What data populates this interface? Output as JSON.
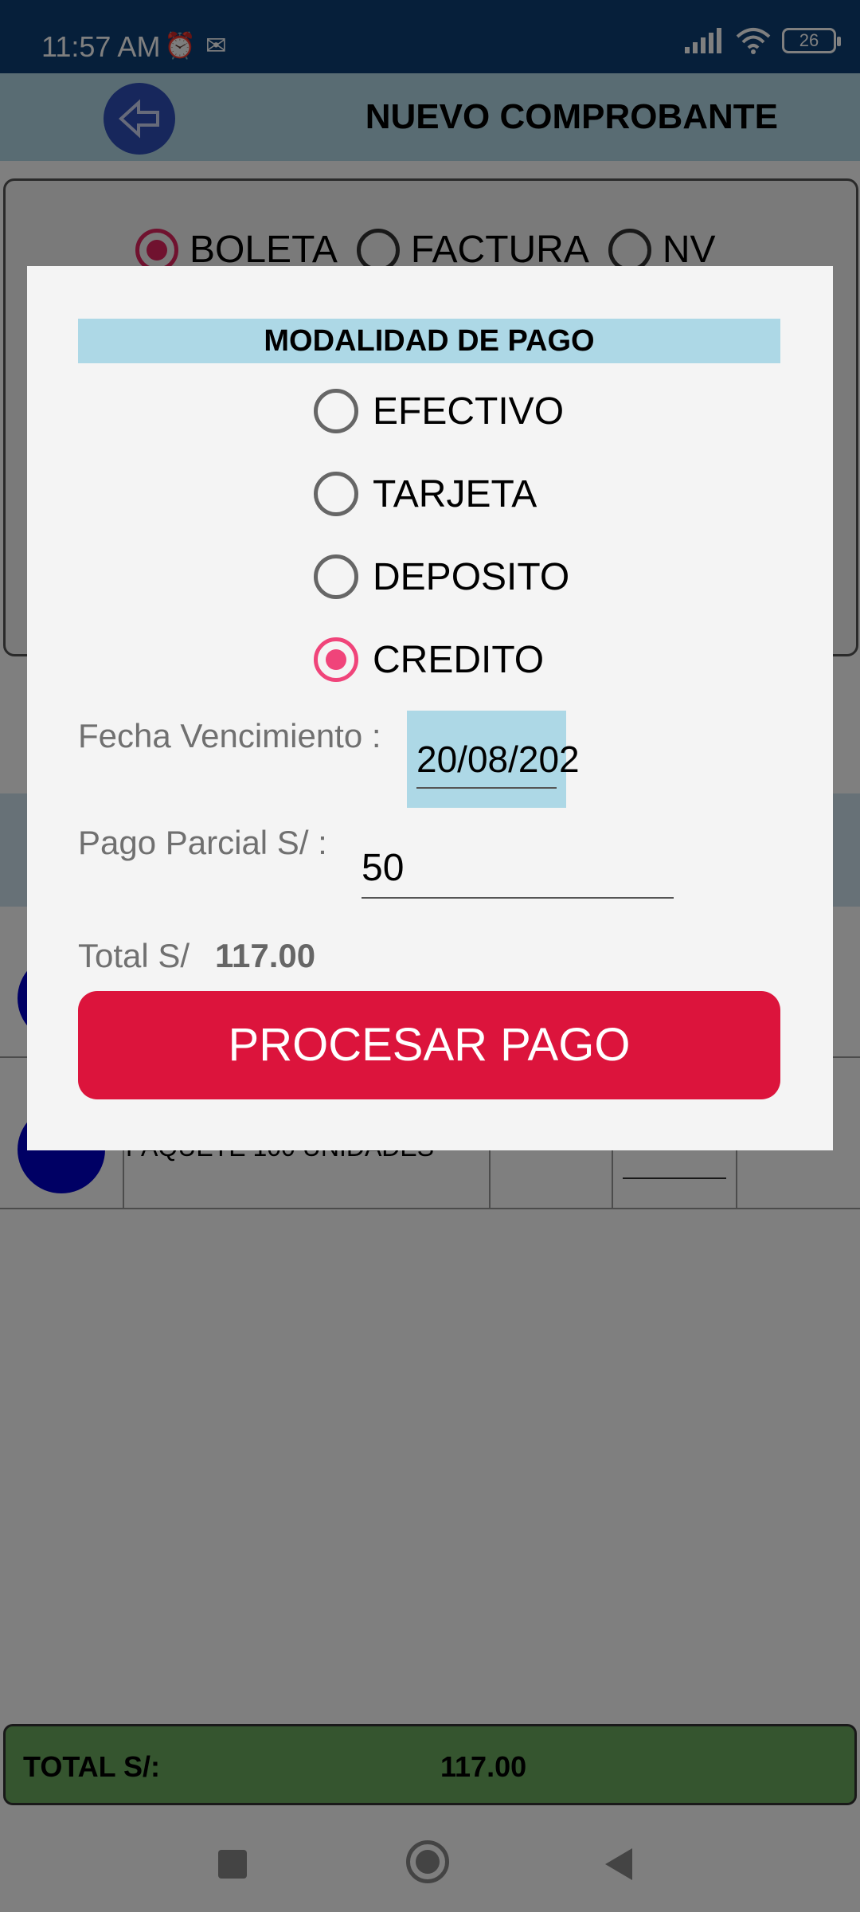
{
  "status_bar": {
    "time": "11:57 AM",
    "battery": "26"
  },
  "header": {
    "title": "NUEVO COMPROBANTE"
  },
  "document_type": {
    "options": [
      "BOLETA",
      "FACTURA",
      "NV"
    ],
    "selected": "BOLETA"
  },
  "items": [
    {
      "description": "PAQUETE 100 UNIDADES"
    }
  ],
  "footer": {
    "total_label": "TOTAL S/:",
    "total_value": "117.00"
  },
  "dialog": {
    "title": "MODALIDAD DE PAGO",
    "options": [
      {
        "label": "EFECTIVO",
        "selected": false
      },
      {
        "label": "TARJETA",
        "selected": false
      },
      {
        "label": "DEPOSITO",
        "selected": false
      },
      {
        "label": "CREDITO",
        "selected": true
      }
    ],
    "due_date_label": "Fecha Vencimiento :",
    "due_date_value": "20/08/202",
    "partial_label": "Pago Parcial S/ :",
    "partial_value": "50",
    "total_label": "Total S/",
    "total_value": "117.00",
    "process_button": "PROCESAR PAGO"
  },
  "colors": {
    "status_bar": "#0d3f74",
    "header_bg": "#b3d9e6",
    "radio_selected": "#f0447a",
    "process_button": "#dc143c",
    "total_bar": "#6aaa5e",
    "dialog_title_bg": "#add8e6"
  }
}
